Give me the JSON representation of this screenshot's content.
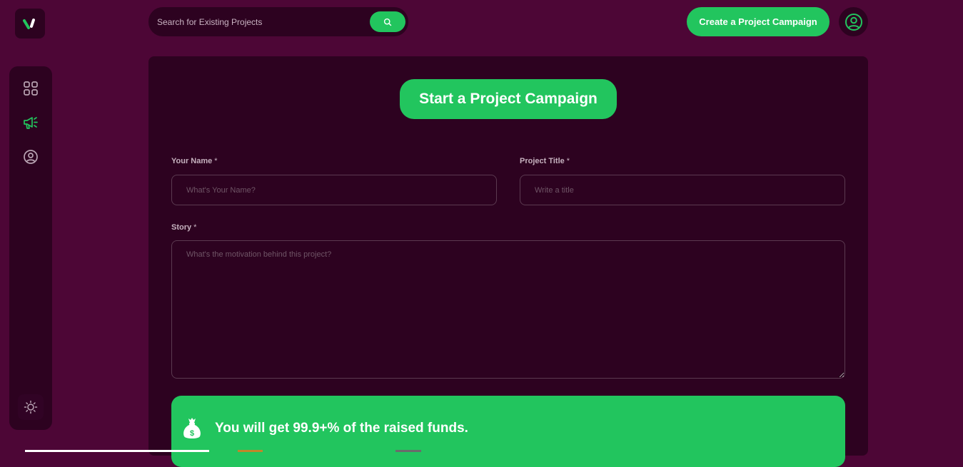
{
  "header": {
    "search": {
      "placeholder": "Search for Existing Projects",
      "button_icon": "search-icon"
    },
    "create_button_label": "Create a Project Campaign",
    "profile_icon": "user-circle-icon"
  },
  "sidebar": {
    "logo_icon": "brand-logo-icon",
    "items": [
      {
        "icon": "dashboard-grid-icon"
      },
      {
        "icon": "megaphone-icon",
        "active": true
      },
      {
        "icon": "user-circle-icon"
      }
    ],
    "theme_toggle_icon": "sun-icon"
  },
  "form": {
    "heading": "Start a Project Campaign",
    "name": {
      "label": "Your Name",
      "required_mark": "*",
      "placeholder": "What's Your Name?"
    },
    "title": {
      "label": "Project Title",
      "required_mark": "*",
      "placeholder": "Write a title"
    },
    "story": {
      "label": "Story",
      "required_mark": "*",
      "placeholder": "What's the motivation behind this project?"
    }
  },
  "banner": {
    "icon": "money-bag-icon",
    "text": "You will get 99.9+% of the raised funds."
  },
  "colors": {
    "background": "#4d0636",
    "panel": "#2d0220",
    "accent": "#22c55e",
    "text": "#e9d6e2"
  }
}
